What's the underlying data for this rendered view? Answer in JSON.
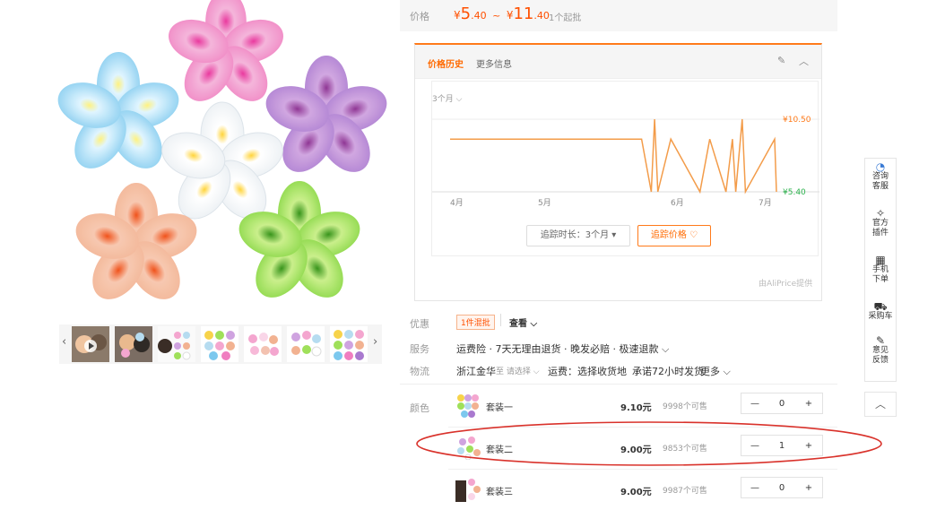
{
  "price": {
    "label": "价格",
    "symbol1": "¥",
    "low_int": "5",
    "low_dec": ".40",
    "sep": "~",
    "symbol2": "¥",
    "high_int": "11",
    "high_dec": ".40",
    "moq": "1个起批"
  },
  "history": {
    "tab_active": "价格历史",
    "tab_more": "更多信息",
    "range_select": "3个月",
    "max_label": "¥10.50",
    "min_label": "¥5.40",
    "months": [
      "4月",
      "5月",
      "6月",
      "7月"
    ],
    "track_duration": "追踪时长：3个月",
    "track_button": "追踪价格",
    "provider": "由AliPrice提供"
  },
  "chart_data": {
    "type": "line",
    "x": [
      "4月",
      "5月",
      "6月",
      "7月"
    ],
    "ylim": [
      5.4,
      10.5
    ],
    "series": [
      {
        "values": [
          9.1,
          9.1,
          9.1,
          9.1,
          9.1,
          5.4,
          10.5,
          5.4,
          9.1,
          5.4,
          9.1,
          5.4,
          9.1,
          5.4,
          10.5,
          5.4,
          9.1,
          9.1,
          5.4
        ]
      }
    ],
    "color": "#f39c4a"
  },
  "promo": {
    "label": "优惠",
    "badge": "1件混批",
    "view": "查看"
  },
  "service": {
    "label": "服务",
    "text": "运费险 · 7天无理由退货 · 晚发必赔 · 极速退款"
  },
  "logistics": {
    "label": "物流",
    "origin": "浙江金华",
    "choose": "至 请选择",
    "fee": "运费：选择收货地",
    "promise": "承诺72小时发货",
    "more": "更多"
  },
  "sku": {
    "label": "颜色",
    "rows": [
      {
        "name": "套装一",
        "price": "9.10元",
        "stock": "9998个可售",
        "qty": "0"
      },
      {
        "name": "套装二",
        "price": "9.00元",
        "stock": "9853个可售",
        "qty": "1"
      },
      {
        "name": "套装三",
        "price": "9.00元",
        "stock": "9987个可售",
        "qty": "0"
      }
    ]
  },
  "sidebar": {
    "items": [
      {
        "label": "咨询客服"
      },
      {
        "label": "官方插件"
      },
      {
        "label": "手机下单"
      },
      {
        "label": "采购车"
      },
      {
        "label": "意见反馈"
      }
    ]
  },
  "colors": {
    "accent": "#ff5000",
    "chart_line": "#f39c4a",
    "annotation": "#d9322b"
  }
}
